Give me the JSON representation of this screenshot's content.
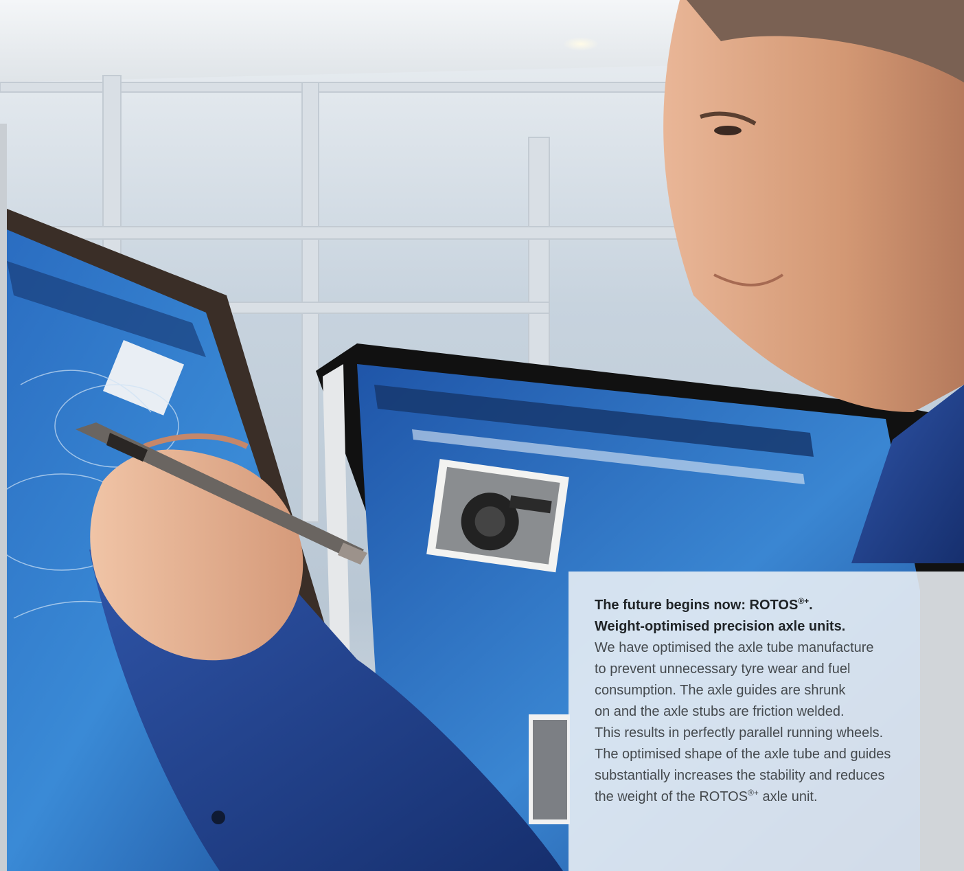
{
  "text_panel": {
    "headline_line1_prefix": "The future begins now: ROTOS",
    "headline_line1_sup": "®+",
    "headline_line1_suffix": ".",
    "headline_line2": "Weight-optimised precision axle units.",
    "body_lines": [
      "We have optimised the axle tube manufacture",
      "to prevent unnecessary tyre wear and fuel",
      "consumption. The axle guides are shrunk",
      "on and the axle stubs are friction welded.",
      "This results in perfectly parallel running wheels.",
      "The optimised shape of the axle tube and guides",
      "substantially increases the stability and reduces"
    ],
    "last_line_prefix": "the weight of the ROTOS",
    "last_line_sup": "®+",
    "last_line_suffix": " axle unit."
  },
  "colors": {
    "panel_background": "#ecf0f5",
    "screen_blue": "#1d4f9c",
    "shirt_blue": "#22408a",
    "window_frame": "#d6dce2"
  }
}
